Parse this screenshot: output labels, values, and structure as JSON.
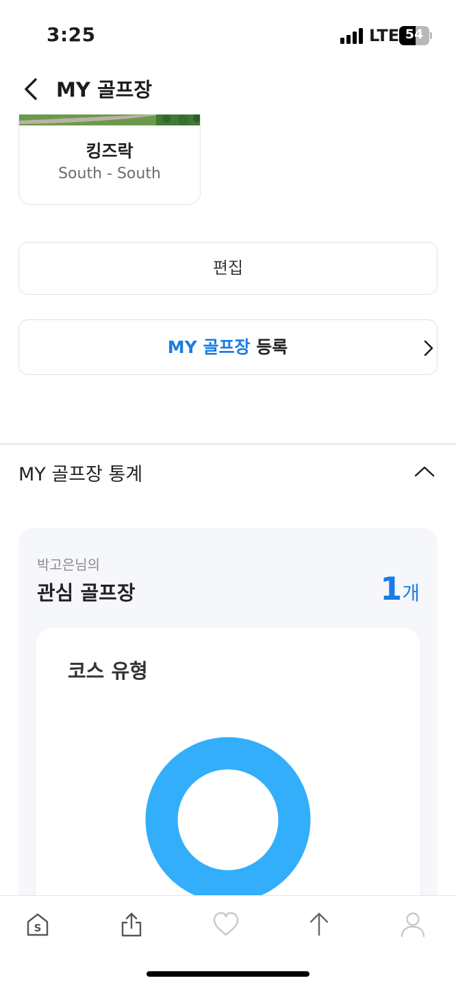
{
  "status_bar": {
    "time": "3:25",
    "network": "LTE",
    "battery_level": "54",
    "battery_fraction": 0.54
  },
  "header": {
    "back_icon": "chevron-left-icon",
    "title": "MY 골프장"
  },
  "course_card": {
    "name": "킹즈락",
    "course": "South - South"
  },
  "buttons": {
    "edit": "편집",
    "register_accent": "MY 골프장",
    "register_rest": " 등록",
    "register_icon": "chevron-right-icon"
  },
  "stats": {
    "title": "MY 골프장 통계",
    "toggle_icon": "chevron-up-icon",
    "owner": "박고은님의",
    "label": "관심 골프장",
    "count": "1",
    "unit": "개",
    "chart_title": "코스 유형"
  },
  "chart_data": {
    "type": "pie",
    "title": "코스 유형",
    "series": [
      {
        "values": [
          1
        ]
      }
    ],
    "colors": [
      "#33aefb"
    ]
  },
  "tab_bar": {
    "items": [
      {
        "icon": "home-s-icon"
      },
      {
        "icon": "share-icon"
      },
      {
        "icon": "heart-icon"
      },
      {
        "icon": "arrow-up-icon"
      },
      {
        "icon": "profile-icon"
      }
    ]
  },
  "colors": {
    "accent": "#1a7ce6",
    "donut": "#33aefb",
    "panel_bg": "#f5f7fb"
  }
}
